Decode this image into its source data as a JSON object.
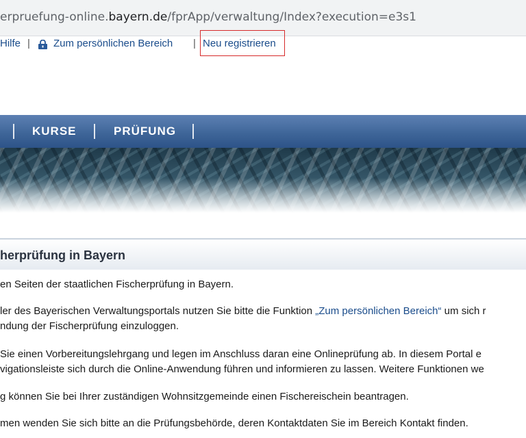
{
  "browser": {
    "url_prefix": "erpruefung-online.",
    "url_domain": "bayern.de",
    "url_path": "/fprApp/verwaltung/Index?execution=e3s1"
  },
  "toplinks": {
    "help": "Hilfe",
    "separator": "|",
    "personal_area": "Zum persönlichen Bereich",
    "register": "Neu registrieren",
    "lock_icon": "lock-icon"
  },
  "nav": {
    "items": [
      "KURSE",
      "PRÜFUNG"
    ]
  },
  "page": {
    "heading": "herprüfung in Bayern",
    "p1": "en Seiten der staatlichen Fischerprüfung in Bayern.",
    "p2a_before": "ler des Bayerischen Verwaltungsportals nutzen Sie bitte die Funktion ",
    "p2a_link": "„Zum persönlichen Bereich“",
    "p2a_after": " um sich r",
    "p2b": "ndung der Fischerprüfung einzuloggen.",
    "p3a": "Sie einen Vorbereitungslehrgang und legen im Anschluss daran eine Onlineprüfung ab. In diesem Portal e",
    "p3b": "vigationsleiste sich durch die Online-Anwendung führen und informieren zu lassen. Weitere Funktionen we",
    "p4": "g können Sie bei Ihrer zuständigen Wohnsitzgemeinde einen Fischereischein beantragen.",
    "p5": "men wenden Sie sich bitte an die Prüfungsbehörde, deren Kontaktdaten Sie im Bereich Kontakt finden."
  },
  "colors": {
    "nav_blue": "#3f6699",
    "link_blue": "#1a4c8b",
    "highlight_red": "#d62a2a"
  }
}
